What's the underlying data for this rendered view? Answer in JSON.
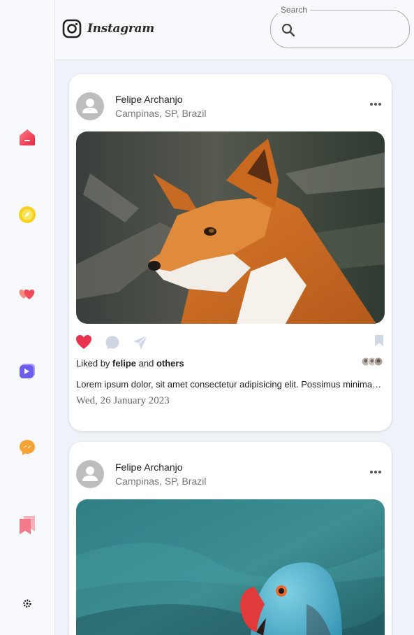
{
  "app": {
    "name": "Instagram"
  },
  "sidebar": {
    "items": [
      {
        "icon": "home-icon",
        "color": "#e8344e"
      },
      {
        "icon": "explore-compass-icon",
        "color": "#f7d11c"
      },
      {
        "icon": "activity-hearts-icon",
        "color": "#f25a5a"
      },
      {
        "icon": "reels-icon",
        "color": "#6c5cf0"
      },
      {
        "icon": "messenger-icon",
        "color": "#f7a234"
      },
      {
        "icon": "saved-icon",
        "color": "#f27a8a"
      }
    ],
    "settings_icon": "gear-icon"
  },
  "search": {
    "label": "Search",
    "value": ""
  },
  "colors": {
    "like": "#e8344e",
    "muted_icon": "#cfd7e3",
    "page_bg": "#eef2f9"
  },
  "posts": [
    {
      "author": "Felipe Archanjo",
      "location": "Campinas, SP, Brazil",
      "image": "red-fox-photo",
      "liked": true,
      "liked_by_prefix": "Liked by",
      "liked_by_user": "felipe",
      "liked_by_and": "and",
      "liked_by_others": "others",
      "caption": "Lorem ipsum dolor, sit amet consectetur adipisicing elit. Possimus minima a, deleniti amet quia laborum.",
      "date": "Wed, 26 January 2023"
    },
    {
      "author": "Felipe Archanjo",
      "location": "Campinas, SP, Brazil",
      "image": "blue-parrot-photo"
    }
  ]
}
